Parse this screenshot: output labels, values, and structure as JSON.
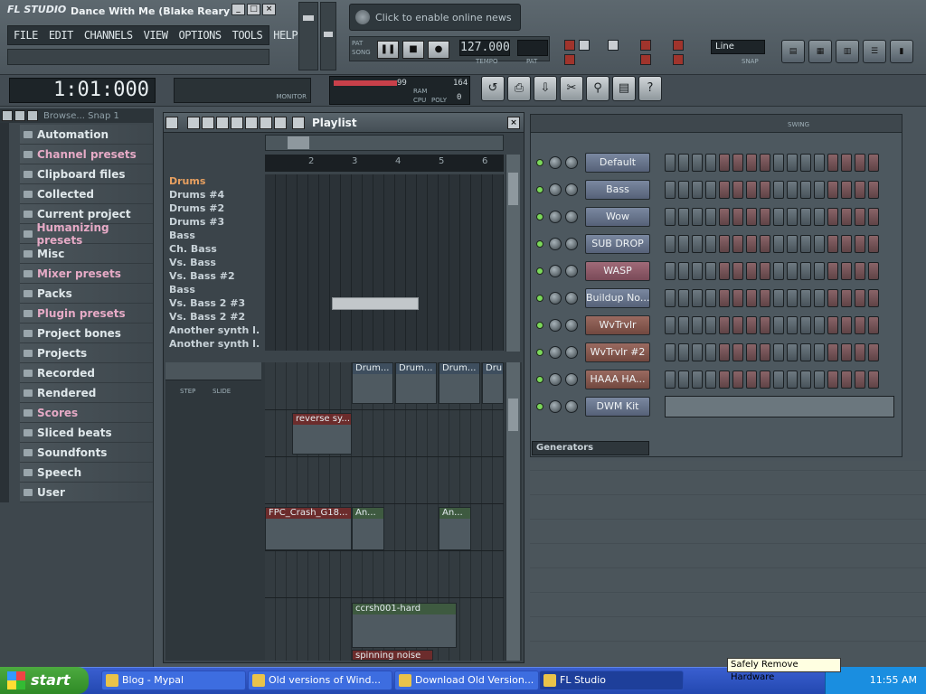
{
  "app": {
    "logo": "FL STUDIO",
    "title": "Dance With Me (Blake Reary's..."
  },
  "window_buttons": [
    "_",
    "□",
    "×"
  ],
  "menu": [
    "FILE",
    "EDIT",
    "CHANNELS",
    "VIEW",
    "OPTIONS",
    "TOOLS",
    "HELP"
  ],
  "news": "Click to enable online news",
  "transport": {
    "pat_label": "PAT",
    "song_label": "SONG",
    "tempo": "127.000",
    "tempo_label": "TEMPO",
    "pat_num_label": "PAT",
    "mode": "Line",
    "snap_label": "SNAP"
  },
  "clock": {
    "time": "1:01:000"
  },
  "monitor_label": "MONITOR",
  "meter": {
    "value1": "99",
    "value2": "164",
    "ram_label": "RAM",
    "cpu_label": "CPU",
    "poly_label": "POLY",
    "value3": "0"
  },
  "browser": {
    "title": "Browse... Snap 1",
    "items": [
      {
        "label": "Automation",
        "pink": false
      },
      {
        "label": "Channel presets",
        "pink": true
      },
      {
        "label": "Clipboard files",
        "pink": false
      },
      {
        "label": "Collected",
        "pink": false
      },
      {
        "label": "Current project",
        "pink": false
      },
      {
        "label": "Humanizing presets",
        "pink": true
      },
      {
        "label": "Misc",
        "pink": false
      },
      {
        "label": "Mixer presets",
        "pink": true
      },
      {
        "label": "Packs",
        "pink": false
      },
      {
        "label": "Plugin presets",
        "pink": true
      },
      {
        "label": "Project bones",
        "pink": false
      },
      {
        "label": "Projects",
        "pink": false
      },
      {
        "label": "Recorded",
        "pink": false
      },
      {
        "label": "Rendered",
        "pink": false
      },
      {
        "label": "Scores",
        "pink": true
      },
      {
        "label": "Sliced beats",
        "pink": false
      },
      {
        "label": "Soundfonts",
        "pink": false
      },
      {
        "label": "Speech",
        "pink": false
      },
      {
        "label": "User",
        "pink": false
      }
    ]
  },
  "playlist": {
    "title": "Playlist",
    "ruler": [
      "2",
      "3",
      "4",
      "5",
      "6"
    ],
    "tracks": [
      "Drums",
      "Drums #4",
      "Drums #2",
      "Drums #3",
      "Bass",
      "Ch. Bass",
      "Vs. Bass",
      "Vs. Bass #2",
      "Bass",
      "Vs. Bass 2 #3",
      "Vs. Bass 2 #2",
      "Another synth l...",
      "Another synth l..."
    ],
    "step_label": "STEP",
    "slide_label": "SLIDE",
    "clips": [
      "Drum...",
      "Drum...",
      "Drum...",
      "Dru",
      "reverse sy...",
      "FPC_Crash_G18...",
      "An...",
      "An...",
      "ccrsh001-hard",
      "spinning noise"
    ]
  },
  "stepseq": {
    "swing_label": "SWING",
    "channels": [
      {
        "name": "Default",
        "color": "blue"
      },
      {
        "name": "Bass",
        "color": "blue"
      },
      {
        "name": "Wow",
        "color": "blue"
      },
      {
        "name": "SUB DROP",
        "color": "blue"
      },
      {
        "name": "WASP",
        "color": "red"
      },
      {
        "name": "Buildup No...",
        "color": "blue"
      },
      {
        "name": "WvTrvlr",
        "color": "brown"
      },
      {
        "name": "WvTrvlr #2",
        "color": "brown"
      },
      {
        "name": "HAAA HA...",
        "color": "brown"
      },
      {
        "name": "DWM Kit",
        "color": "blue"
      }
    ],
    "generators": "Generators"
  },
  "taskbar": {
    "start": "start",
    "tasks": [
      "Blog - Mypal",
      "Old versions of Wind...",
      "Download Old Version...",
      "FL Studio"
    ],
    "time": "11:55 AM",
    "tooltip": "Safely Remove Hardware"
  }
}
